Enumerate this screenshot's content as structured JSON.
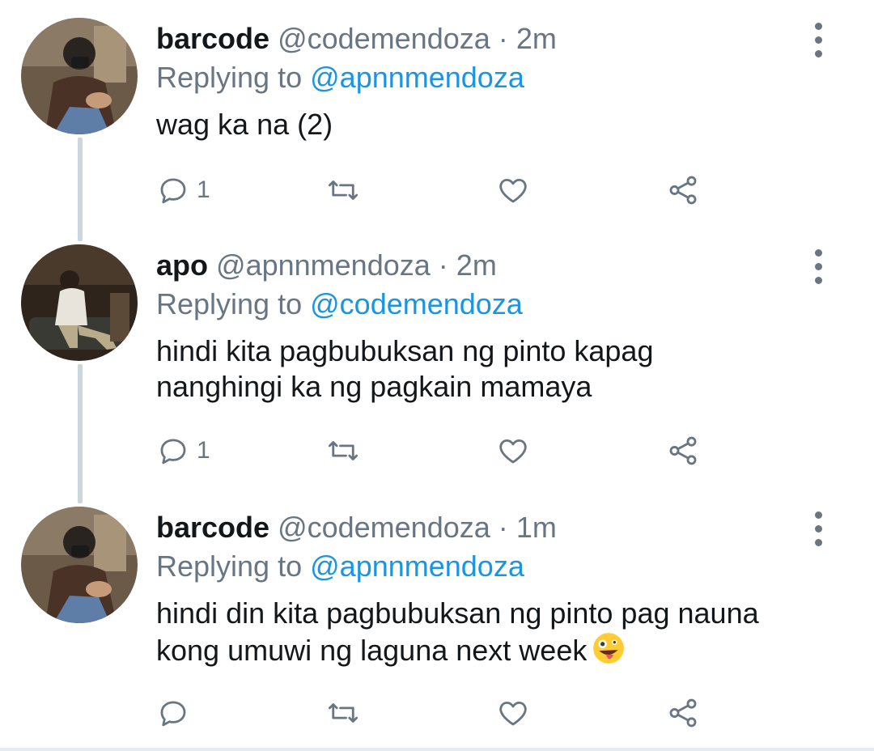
{
  "tweets": [
    {
      "display_name": "barcode",
      "handle": "@codemendoza",
      "separator": "·",
      "time": "2m",
      "replying_prefix": "Replying to",
      "replying_to": "@apnnmendoza",
      "text_lines": [
        "wag ka na (2)"
      ],
      "reply_count": "1",
      "retweet_count": "",
      "like_count": ""
    },
    {
      "display_name": "apo",
      "handle": "@apnnmendoza",
      "separator": "·",
      "time": "2m",
      "replying_prefix": "Replying to",
      "replying_to": "@codemendoza",
      "text_lines": [
        "hindi kita pagbubuksan ng pinto kapag",
        "nanghingi ka ng pagkain mamaya"
      ],
      "reply_count": "1",
      "retweet_count": "",
      "like_count": ""
    },
    {
      "display_name": "barcode",
      "handle": "@codemendoza",
      "separator": "·",
      "time": "1m",
      "replying_prefix": "Replying to",
      "replying_to": "@apnnmendoza",
      "text_lines": [
        "hindi din kita pagbubuksan ng pinto pag nauna",
        "kong umuwi ng laguna next week"
      ],
      "reply_count": "",
      "retweet_count": "",
      "like_count": ""
    }
  ],
  "icons": {
    "reply": "reply-icon",
    "retweet": "retweet-icon",
    "like": "heart-icon",
    "share": "share-icon",
    "more": "more-vertical-icon",
    "emoji": "zany-face-emoji"
  },
  "colors": {
    "text": "#14171a",
    "muted": "#687684",
    "link": "#1b95e0",
    "thread_line": "#ccd6dd"
  }
}
